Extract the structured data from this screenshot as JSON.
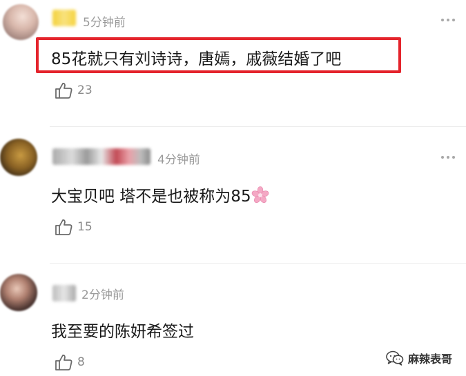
{
  "comments": [
    {
      "time": "5分钟前",
      "text": "85花就只有刘诗诗，唐嫣，戚薇结婚了吧",
      "likes": "23"
    },
    {
      "time": "4分钟前",
      "text": "大宝贝吧 塔不是也被称为85",
      "likes": "15"
    },
    {
      "time": "2分钟前",
      "text": "我至要的陈妍希签过",
      "likes": "8"
    }
  ],
  "watermark": {
    "text": "麻辣表哥"
  },
  "colors": {
    "highlight": "#e4242c",
    "secondary_text": "#9a9a9a",
    "divider": "#ececec"
  },
  "icons": {
    "like": "thumbs-up-icon",
    "more": "more-dots-icon",
    "flower": "cherry-blossom-emoji",
    "watermark": "wechat-icon"
  }
}
